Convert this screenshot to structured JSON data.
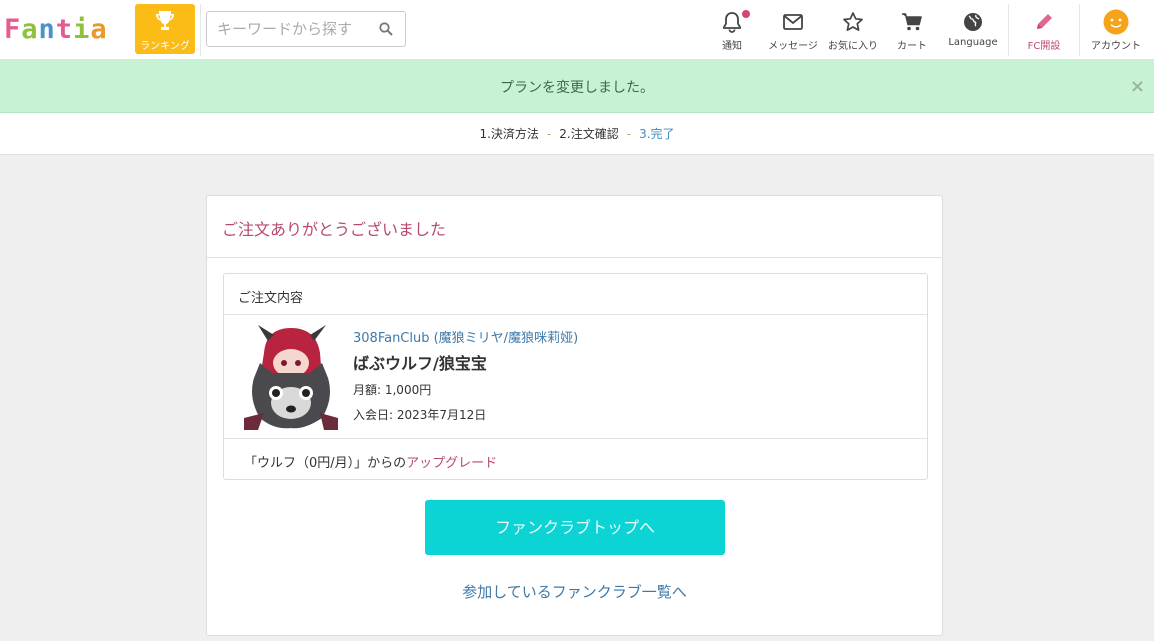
{
  "header": {
    "logo_letters": [
      "F",
      "a",
      "n",
      "t",
      "i",
      "a"
    ],
    "logo_colors": [
      "#e55c8e",
      "#8fc13e",
      "#4a90c9",
      "#e55c8e",
      "#8fc13e",
      "#e89a2c"
    ],
    "ranking_label": "ランキング",
    "search_placeholder": "キーワードから探す",
    "nav": [
      {
        "label": "通知",
        "icon": "bell-icon",
        "badge": true
      },
      {
        "label": "メッセージ",
        "icon": "envelope-icon"
      },
      {
        "label": "お気に入り",
        "icon": "star-icon"
      },
      {
        "label": "カート",
        "icon": "cart-icon"
      },
      {
        "label": "Language",
        "icon": "globe-icon"
      },
      {
        "label": "FC開設",
        "icon": "pencil-icon"
      },
      {
        "label": "アカウント",
        "icon": "smiley-avatar-icon"
      }
    ]
  },
  "flash": {
    "message": "プランを変更しました。",
    "close": "×"
  },
  "steps": [
    {
      "label": "1.決済方法",
      "active": false
    },
    {
      "label": "2.注文確認",
      "active": false
    },
    {
      "label": "3.完了",
      "active": true
    }
  ],
  "steps_separator": "-",
  "card": {
    "title": "ご注文ありがとうございました",
    "order_heading": "ご注文内容",
    "fanclub_name": "308FanClub (魔狼ミリヤ/魔狼咪莉娅)",
    "plan_name": "ばぶウルフ/狼宝宝",
    "price": "月額: 1,000円",
    "joined": "入会日: 2023年7月12日",
    "upgrade_prefix": "「ウルフ（0円/月）」からの",
    "upgrade_highlight": "アップグレード",
    "cta_label": "ファンクラブトップへ",
    "list_link": "参加しているファンクラブ一覧へ"
  },
  "colors": {
    "ranking_bg": "#fbbc18",
    "flash_bg": "#c7f2d3",
    "title_pink": "#b8496f",
    "link_blue": "#3f79a8",
    "cta_bg": "#0dd4d4"
  }
}
